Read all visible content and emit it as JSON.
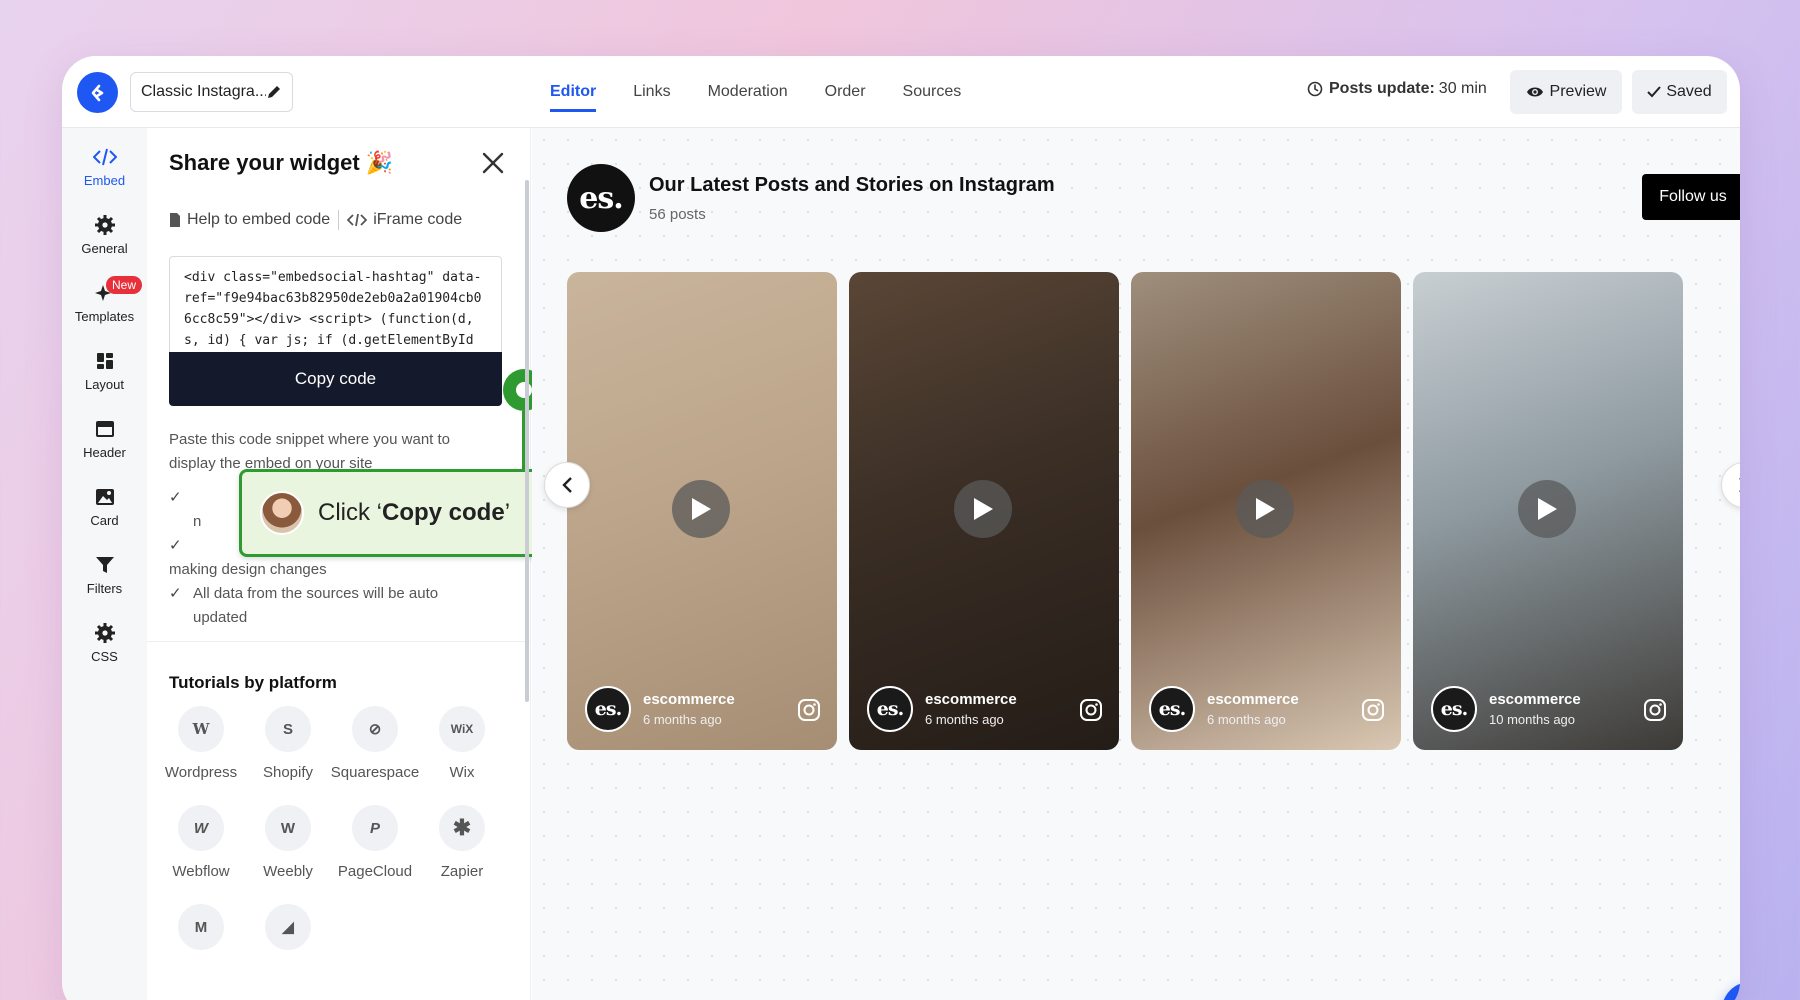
{
  "topbar": {
    "widget_name": "Classic Instagra...",
    "tabs": [
      {
        "label": "Editor",
        "active": true
      },
      {
        "label": "Links"
      },
      {
        "label": "Moderation"
      },
      {
        "label": "Order"
      },
      {
        "label": "Sources"
      }
    ],
    "posts_update_label": "Posts update:",
    "posts_update_value": "30 min",
    "preview_label": "Preview",
    "saved_label": "Saved"
  },
  "sidebar": {
    "items": [
      {
        "label": "Embed",
        "icon": "code-icon",
        "active": true
      },
      {
        "label": "General",
        "icon": "gear-icon"
      },
      {
        "label": "Templates",
        "icon": "sparkle-icon",
        "badge": "New"
      },
      {
        "label": "Layout",
        "icon": "layout-icon"
      },
      {
        "label": "Header",
        "icon": "header-icon"
      },
      {
        "label": "Card",
        "icon": "image-icon"
      },
      {
        "label": "Filters",
        "icon": "filter-icon"
      },
      {
        "label": "CSS",
        "icon": "gear-icon"
      }
    ]
  },
  "panel": {
    "title": "Share your widget 🎉",
    "help_link": "Help to embed code",
    "iframe_link": "iFrame code",
    "code_snippet": "<div class=\"embedsocial-hashtag\" data-ref=\"f9e94bac63b82950de2eb0a2a01904cb06cc8c59\"></div> <script> (function(d, s, id) { var js; if (d.getElementById(id)) {return;} js =",
    "copy_button": "Copy code",
    "paste_text": "Paste this code snippet where you want to display the embed on your site",
    "checks": [
      "n",
      "making design changes",
      "All data from the sources will be auto updated"
    ],
    "tooltip_prefix": "Click ‘",
    "tooltip_bold": "Copy code",
    "tooltip_suffix": "’",
    "tutorials_title": "Tutorials by platform",
    "platforms": [
      {
        "label": "Wordpress",
        "glyph": "W"
      },
      {
        "label": "Shopify",
        "glyph": "S"
      },
      {
        "label": "Squarespace",
        "glyph": "⊘"
      },
      {
        "label": "Wix",
        "glyph": "WiX"
      },
      {
        "label": "Webflow",
        "glyph": "W"
      },
      {
        "label": "Weebly",
        "glyph": "W"
      },
      {
        "label": "PageCloud",
        "glyph": "P"
      },
      {
        "label": "Zapier",
        "glyph": "✱"
      },
      {
        "label": "",
        "glyph": "M"
      },
      {
        "label": "",
        "glyph": "◢"
      }
    ]
  },
  "feed": {
    "avatar_text": "es.",
    "title": "Our Latest Posts and Stories on Instagram",
    "count": "56 posts",
    "follow_button": "Follow us",
    "cards": [
      {
        "user": "escommerce",
        "time": "6 months ago",
        "bg": "linear-gradient(160deg,#c9b59c 0%,#bca58a 45%,#a58e74 100%)"
      },
      {
        "user": "escommerce",
        "time": "6 months ago",
        "bg": "linear-gradient(160deg,#5a4636 0%,#3a2e25 45%,#241c17 100%)"
      },
      {
        "user": "escommerce",
        "time": "6 months ago",
        "bg": "linear-gradient(160deg,#9f8f7d 0%,#6b4f3d 45%,#d9c8b3 100%)"
      },
      {
        "user": "escommerce",
        "time": "10 months ago",
        "bg": "linear-gradient(160deg,#c8cfd3 0%,#8e9aa0 45%,#3d3a36 100%)"
      }
    ]
  },
  "colors": {
    "accent": "#1f57f2",
    "step": "#2f9a2f",
    "copy_button": "#141a2b"
  }
}
